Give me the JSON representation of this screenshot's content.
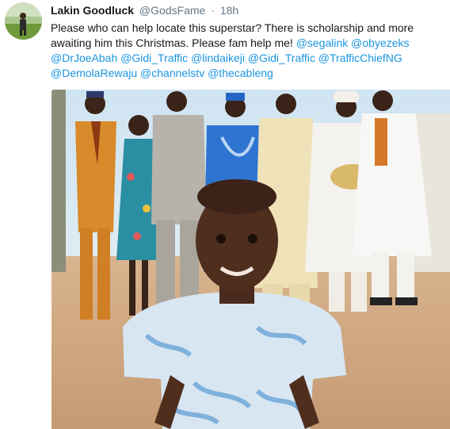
{
  "tweet": {
    "author_name": "Lakin Goodluck",
    "handle": "@GodsFame",
    "separator": "·",
    "time": "18h",
    "text_intro": "Please who can help locate this superstar? There is scholarship and more awaiting him this Christmas. Please fam help me!",
    "mentions": [
      "@segalink",
      "@obyezeks",
      "@DrJoeAbah",
      "@Gidi_Traffic",
      "@lindaikeji",
      "@Gidi_Traffic",
      "@TrafficChiefNG",
      "@DemolaRewaju",
      "@channelstv",
      "@thecableng"
    ]
  },
  "colors": {
    "name": "#14171a",
    "meta": "#657786",
    "link": "#1b95e0"
  },
  "media": {
    "subject": "photo of smiling boy in blue-patterned outfit, group of adults in traditional attire behind"
  }
}
